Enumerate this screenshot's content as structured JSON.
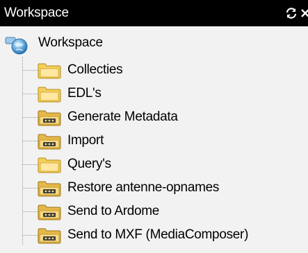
{
  "panel": {
    "title": "Workspace",
    "header_icons": [
      "refresh-icon",
      "close-icon"
    ]
  },
  "tree": {
    "root": {
      "label": "Workspace",
      "icon": "workspace-globe-icon"
    },
    "items": [
      {
        "label": "Collecties",
        "icon": "folder-empty-icon"
      },
      {
        "label": "EDL's",
        "icon": "folder-empty-icon"
      },
      {
        "label": "Generate Metadata",
        "icon": "folder-media-icon"
      },
      {
        "label": "Import",
        "icon": "folder-media-icon"
      },
      {
        "label": "Query's",
        "icon": "folder-empty-icon"
      },
      {
        "label": "Restore antenne-opnames",
        "icon": "folder-media-icon"
      },
      {
        "label": "Send to Ardome",
        "icon": "folder-media-icon"
      },
      {
        "label": "Send to MXF (MediaComposer)",
        "icon": "folder-media-icon"
      }
    ]
  },
  "colors": {
    "titlebar_bg": "#000000",
    "titlebar_text": "#ffffff",
    "panel_bg": "#f2f2f2",
    "folder_yellow": "#f4cf5a"
  }
}
